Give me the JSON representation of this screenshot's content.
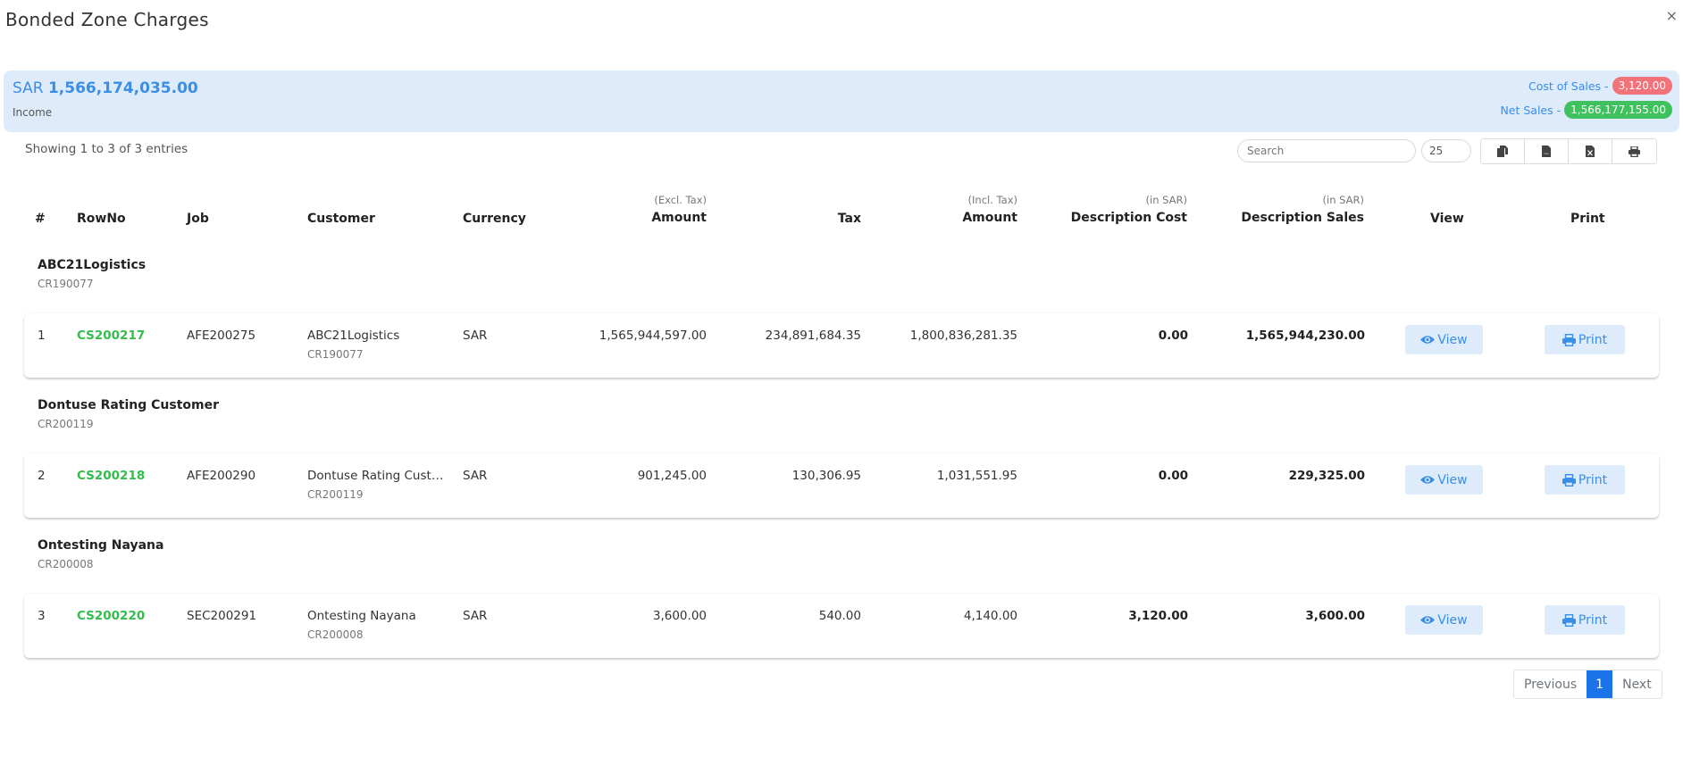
{
  "modal": {
    "title": "Bonded Zone Charges",
    "close_label": "×"
  },
  "summary": {
    "currency": "SAR",
    "income_amount": "1,566,174,035.00",
    "income_label": "Income",
    "cost_of_sales_label": "Cost of Sales -",
    "cost_of_sales_value": "3,120.00",
    "net_sales_label": "Net Sales -",
    "net_sales_value": "1,566,177,155.00",
    "colors": {
      "accent": "#3a8ee6",
      "background": "#deebfb",
      "cost_badge": "#f2727a",
      "net_badge": "#3fc25d"
    }
  },
  "toolbar": {
    "showing_text": "Showing 1 to 3 of 3 entries",
    "search_placeholder": "Search",
    "page_length": "25",
    "export_buttons": [
      {
        "icon": "copy-icon",
        "label": "Copy"
      },
      {
        "icon": "csv-icon",
        "label": "CSV"
      },
      {
        "icon": "excel-icon",
        "label": "Excel"
      },
      {
        "icon": "print-icon",
        "label": "Print"
      }
    ]
  },
  "table": {
    "columns": [
      {
        "key": "index",
        "label": "#",
        "sub": ""
      },
      {
        "key": "rowno",
        "label": "RowNo",
        "sub": ""
      },
      {
        "key": "job",
        "label": "Job",
        "sub": ""
      },
      {
        "key": "customer",
        "label": "Customer",
        "sub": ""
      },
      {
        "key": "currency",
        "label": "Currency",
        "sub": ""
      },
      {
        "key": "amount_excl",
        "label": "Amount",
        "sub": "(Excl. Tax)"
      },
      {
        "key": "tax",
        "label": "Tax",
        "sub": ""
      },
      {
        "key": "amount_incl",
        "label": "Amount",
        "sub": "(Incl. Tax)"
      },
      {
        "key": "desc_cost",
        "label": "Description Cost",
        "sub": "(in SAR)"
      },
      {
        "key": "desc_sales",
        "label": "Description Sales",
        "sub": "(in SAR)"
      },
      {
        "key": "view",
        "label": "View",
        "sub": ""
      },
      {
        "key": "print",
        "label": "Print",
        "sub": ""
      }
    ],
    "groups": [
      {
        "name": "ABC21Logistics",
        "code": "CR190077",
        "row": {
          "index": "1",
          "rowno": "CS200217",
          "job": "AFE200275",
          "customer": "ABC21Logistics",
          "customer_code": "CR190077",
          "currency": "SAR",
          "amount_excl": "1,565,944,597.00",
          "tax": "234,891,684.35",
          "amount_incl": "1,800,836,281.35",
          "desc_cost": "0.00",
          "desc_sales": "1,565,944,230.00",
          "view_label": "View",
          "print_label": "Print"
        }
      },
      {
        "name": "Dontuse Rating Customer",
        "code": "CR200119",
        "row": {
          "index": "2",
          "rowno": "CS200218",
          "job": "AFE200290",
          "customer": "Dontuse Rating Customer",
          "customer_code": "CR200119",
          "currency": "SAR",
          "amount_excl": "901,245.00",
          "tax": "130,306.95",
          "amount_incl": "1,031,551.95",
          "desc_cost": "0.00",
          "desc_sales": "229,325.00",
          "view_label": "View",
          "print_label": "Print"
        }
      },
      {
        "name": "Ontesting Nayana",
        "code": "CR200008",
        "row": {
          "index": "3",
          "rowno": "CS200220",
          "job": "SEC200291",
          "customer": "Ontesting Nayana",
          "customer_code": "CR200008",
          "currency": "SAR",
          "amount_excl": "3,600.00",
          "tax": "540.00",
          "amount_incl": "4,140.00",
          "desc_cost": "3,120.00",
          "desc_sales": "3,600.00",
          "view_label": "View",
          "print_label": "Print"
        }
      }
    ]
  },
  "pagination": {
    "previous_label": "Previous",
    "current_page": "1",
    "next_label": "Next"
  }
}
